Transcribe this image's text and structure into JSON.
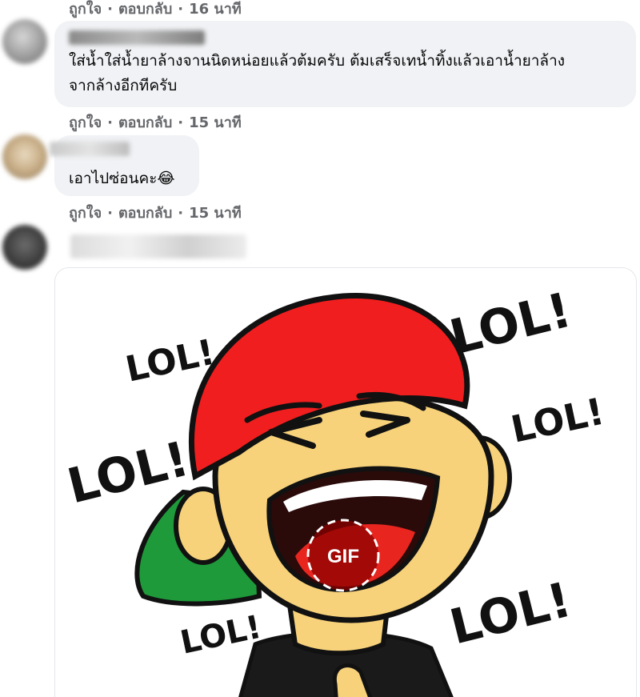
{
  "comments": [
    {
      "like_label": "ถูกใจ",
      "reply_label": "ตอบกลับ",
      "timestamp": "16 นาที"
    },
    {
      "text_lines": [
        "ใส่น้ำใส่น้ำยาล้างจานนิดหน่อยแล้วต้มครับ ต้มเสร็จเทน้ำทิ้งแล้วเอาน้ำยาล้าง",
        "จากล้างอีกทีครับ"
      ],
      "like_label": "ถูกใจ",
      "reply_label": "ตอบกลับ",
      "timestamp": "15 นาที"
    },
    {
      "text": "เอาไปซ่อนคะ",
      "emoji": "😂",
      "like_label": "ถูกใจ",
      "reply_label": "ตอบกลับ",
      "timestamp": "15 นาที"
    }
  ],
  "gif_comment": {
    "gif": {
      "badge_label": "GIF",
      "sticker_words": [
        "LOL!",
        "LOL!",
        "LOL!",
        "LOL!",
        "LOL!",
        "LOL!"
      ],
      "colors": {
        "cap": "#f01e1e",
        "visor": "#1f9a3a",
        "skin": "#f7d27a",
        "mouth": "#2b0a0a",
        "tongue": "#e8261f",
        "shirt": "#1a1a1a",
        "badge_bg": "#8b0000"
      }
    }
  },
  "colors": {
    "bubble_bg": "#f0f2f5",
    "meta_text": "#65676b",
    "body_text": "#050505"
  }
}
